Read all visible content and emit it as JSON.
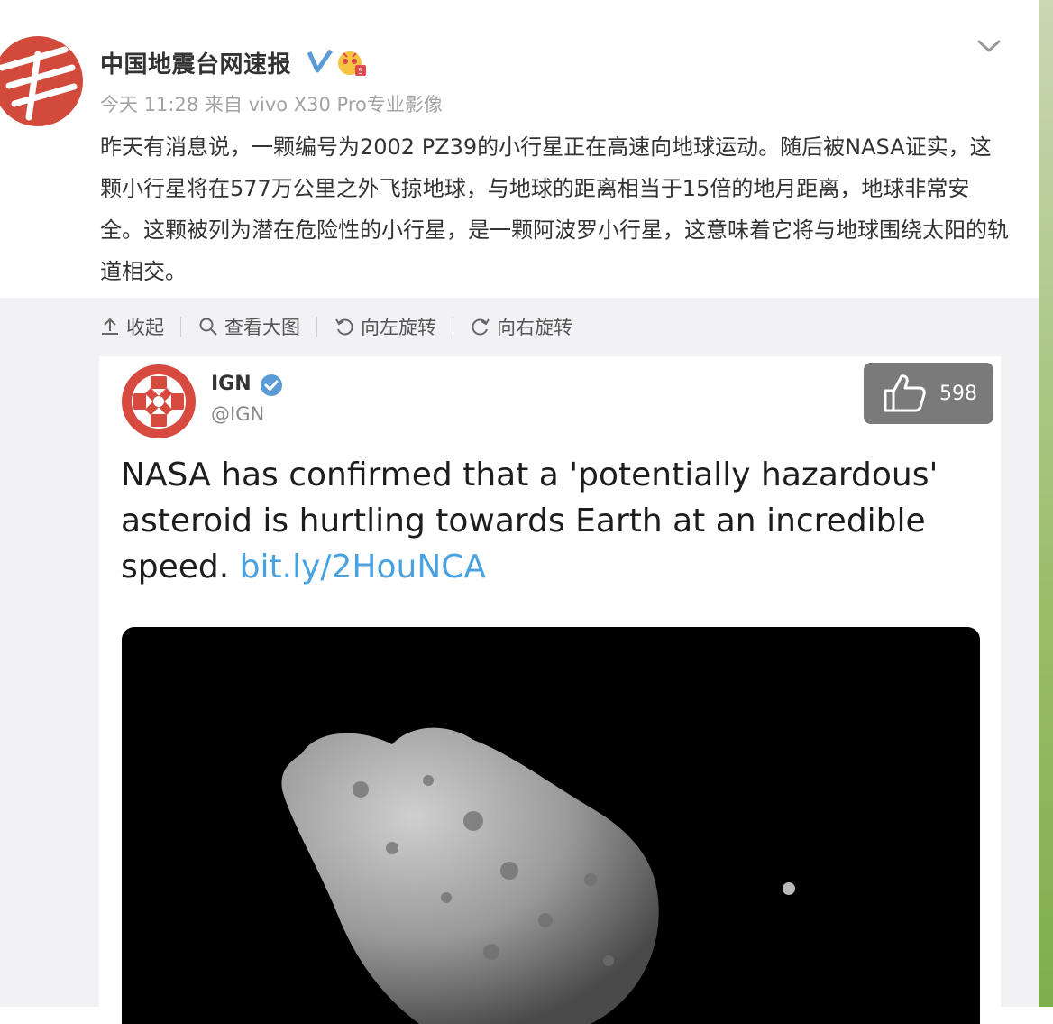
{
  "post": {
    "author": "中国地震台网速报",
    "time": "今天 11:28",
    "source": "来自 vivo X30 Pro专业影像",
    "text": "昨天有消息说，一颗编号为2002 PZ39的小行星正在高速向地球运动。随后被NASA证实，这颗小行星将在577万公里之外飞掠地球，与地球的距离相当于15倍的地月距离，地球非常安全。这颗被列为潜在危险性的小行星，是一颗阿波罗小行星，这意味着它将与地球围绕太阳的轨道相交。"
  },
  "toolbar": {
    "collapse_label": "收起",
    "view_large_label": "查看大图",
    "rotate_left_label": "向左旋转",
    "rotate_right_label": "向右旋转"
  },
  "embed": {
    "account_name": "IGN",
    "handle": "@IGN",
    "tweet_text": "NASA has confirmed that a 'potentially hazardous' asteroid is hurtling towards Earth at an incredible speed. ",
    "tweet_link": "bit.ly/2HouNCA"
  },
  "like": {
    "count": "598"
  },
  "icons": {
    "verified": "verified-v-icon",
    "badge": "member-badge-icon",
    "more": "chevron-down-icon",
    "like": "thumbs-up-icon"
  },
  "colors": {
    "link": "#4aa3e0",
    "verified": "#5b9bd5",
    "ign_red": "#d64a3f"
  }
}
